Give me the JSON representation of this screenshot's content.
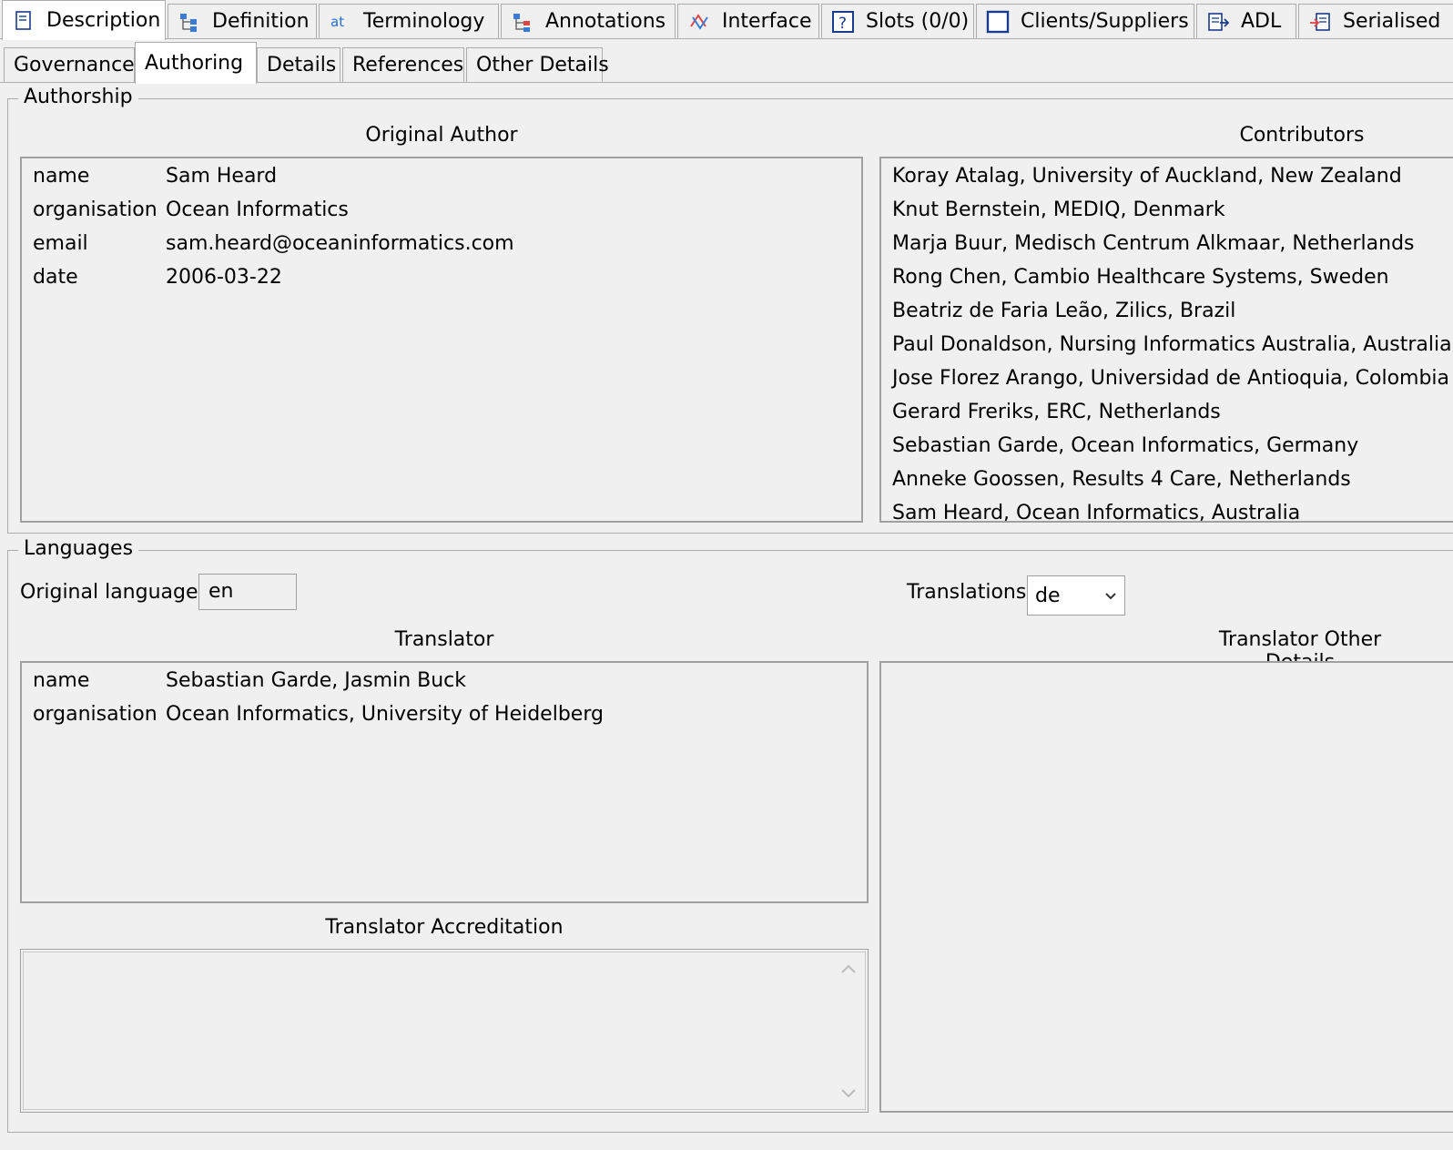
{
  "main_tabs": [
    {
      "label": "Description",
      "icon": "description-icon"
    },
    {
      "label": "Definition",
      "icon": "definition-icon"
    },
    {
      "label": "Terminology",
      "icon": "terminology-icon"
    },
    {
      "label": "Annotations",
      "icon": "annotations-icon"
    },
    {
      "label": "Interface",
      "icon": "interface-icon"
    },
    {
      "label": "Slots (0/0)",
      "icon": "slots-icon"
    },
    {
      "label": "Clients/Suppliers",
      "icon": "clients-suppliers-icon"
    },
    {
      "label": "ADL",
      "icon": "adl-icon"
    },
    {
      "label": "Serialised",
      "icon": "serialised-icon"
    }
  ],
  "sub_tabs": [
    "Governance",
    "Authoring",
    "Details",
    "References",
    "Other Details"
  ],
  "authorship": {
    "title": "Authorship",
    "original_author_label": "Original Author",
    "contributors_label": "Contributors",
    "original_author": [
      {
        "key": "name",
        "value": "Sam Heard"
      },
      {
        "key": "organisation",
        "value": "Ocean Informatics"
      },
      {
        "key": "email",
        "value": "sam.heard@oceaninformatics.com"
      },
      {
        "key": "date",
        "value": "2006-03-22"
      }
    ],
    "contributors": [
      "Koray Atalag, University of Auckland, New Zealand",
      "Knut Bernstein, MEDIQ, Denmark",
      "Marja Buur, Medisch Centrum Alkmaar, Netherlands",
      "Rong Chen, Cambio Healthcare Systems, Sweden",
      "Beatriz de Faria Leão, Zilics, Brazil",
      "Paul Donaldson, Nursing Informatics Australia, Australia",
      "Jose Florez Arango, Universidad de Antioquia, Colombia",
      "Gerard Freriks, ERC, Netherlands",
      "Sebastian Garde, Ocean Informatics, Germany",
      "Anneke Goossen, Results 4 Care, Netherlands",
      "Sam Heard, Ocean Informatics, Australia"
    ]
  },
  "languages": {
    "title": "Languages",
    "original_language_label": "Original language:",
    "original_language_value": "en",
    "translations_label": "Translations",
    "translations_value": "de",
    "translator_label": "Translator",
    "translator_other_details_label": "Translator Other Details",
    "translator_accreditation_label": "Translator Accreditation",
    "translator": [
      {
        "key": "name",
        "value": "Sebastian Garde, Jasmin Buck"
      },
      {
        "key": "organisation",
        "value": "Ocean Informatics, University of Heidelberg"
      }
    ]
  }
}
